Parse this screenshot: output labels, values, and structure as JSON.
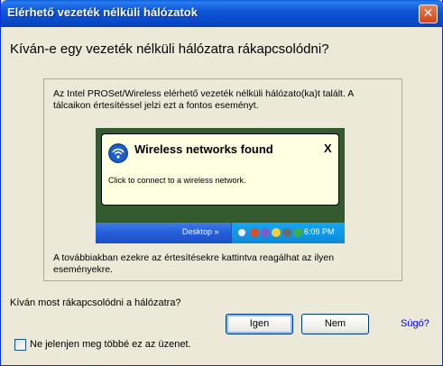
{
  "window": {
    "title": "Elérhető vezeték nélküli hálózatok",
    "close_glyph": "✕"
  },
  "question": "Kíván-e egy vezeték nélküli hálózatra rákapcsolódni?",
  "panel": {
    "intro_line1": "Az Intel PROSet/Wireless elérhető vezeték nélküli hálózato(ka)t talált. A",
    "intro_line2": "tálcaikon értesítéssel jelzi ezt a fontos eseményt.",
    "outro_line1": "A továbbiakban ezekre az értesítésekre kattintva reagálhat az ilyen",
    "outro_line2": "eseményekre."
  },
  "notification": {
    "icon": "wireless-icon",
    "title": "Wireless networks found",
    "close": "X",
    "body": "Click to connect to a wireless network.",
    "taskbar_label": "Desktop",
    "taskbar_chevrons": "»",
    "clock": "6:09 PM"
  },
  "prompt": "Kíván most rákapcsolódni a hálózatra?",
  "buttons": {
    "yes": "Igen",
    "no": "Nem",
    "help": "Súgó?"
  },
  "checkbox": {
    "label": "Ne jelenjen meg többé ez az üzenet.",
    "checked": false
  },
  "colors": {
    "titlebar": "#0A5FD8",
    "close": "#D3431E",
    "window_bg": "#ECE9D8",
    "balloon_bg": "#FFFFE1",
    "link": "#0000FF"
  }
}
